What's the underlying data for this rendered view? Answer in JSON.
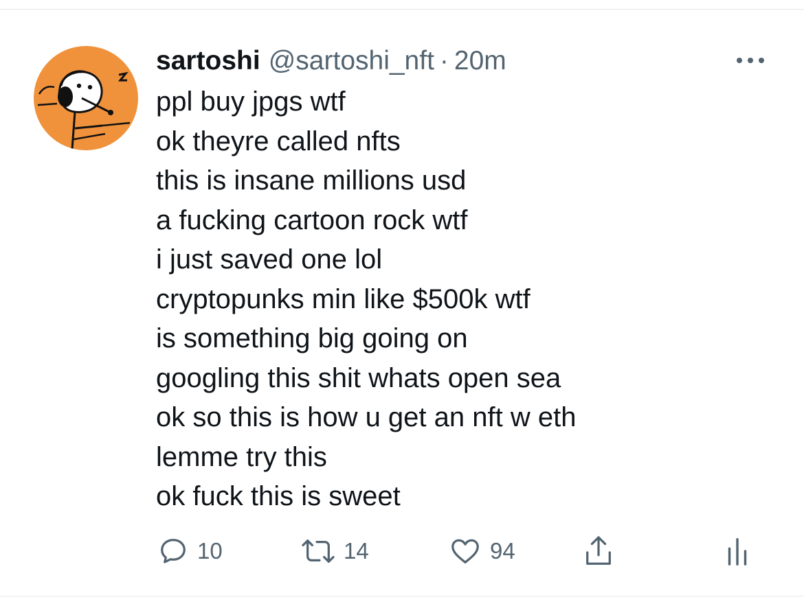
{
  "tweet": {
    "author": {
      "display_name": "sartoshi",
      "handle": "@sartoshi_nft",
      "avatar_icon": "cartoon-avatar",
      "avatar_color": "#f0923c"
    },
    "separator": "·",
    "time": "20m",
    "lines": [
      "ppl buy jpgs wtf",
      "ok theyre called nfts",
      "this is insane millions usd",
      "a fucking cartoon rock wtf",
      "i just saved one lol",
      "cryptopunks min like $500k wtf",
      "is something big going on",
      "googling this shit whats open sea",
      "ok so this is how u get an nft w eth",
      "lemme try this",
      "ok fuck this is sweet"
    ],
    "actions": {
      "reply": {
        "icon": "reply-icon",
        "count": "10"
      },
      "retweet": {
        "icon": "retweet-icon",
        "count": "14"
      },
      "like": {
        "icon": "heart-icon",
        "count": "94"
      },
      "share": {
        "icon": "share-icon"
      },
      "analytics": {
        "icon": "analytics-icon"
      }
    },
    "more_icon": "more-icon"
  },
  "colors": {
    "text_primary": "#0f1419",
    "text_secondary": "#536471",
    "divider": "#e3e6e8",
    "avatar_bg": "#f0923c"
  }
}
